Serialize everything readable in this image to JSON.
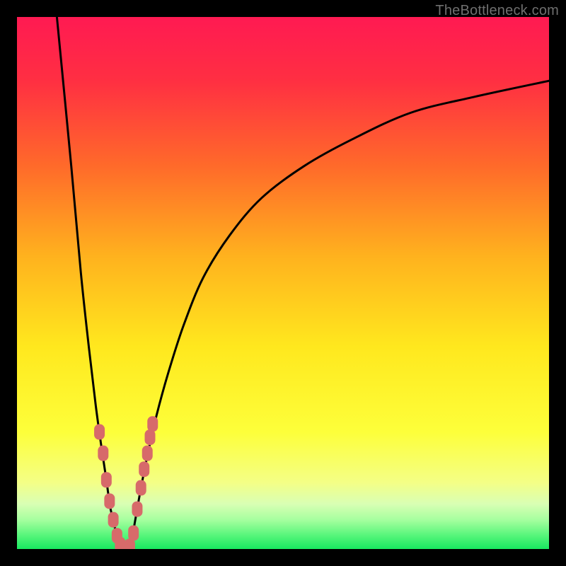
{
  "attribution": "TheBottleneck.com",
  "colors": {
    "frame": "#000000",
    "curve": "#000000",
    "marker": "#d76a6a",
    "gradient_stops": [
      {
        "offset": 0.0,
        "color": "#ff1a52"
      },
      {
        "offset": 0.12,
        "color": "#ff2f42"
      },
      {
        "offset": 0.28,
        "color": "#ff6a2a"
      },
      {
        "offset": 0.45,
        "color": "#ffb21e"
      },
      {
        "offset": 0.62,
        "color": "#ffe81e"
      },
      {
        "offset": 0.78,
        "color": "#fdff3a"
      },
      {
        "offset": 0.875,
        "color": "#f4ff86"
      },
      {
        "offset": 0.915,
        "color": "#d9ffb4"
      },
      {
        "offset": 0.945,
        "color": "#a6ff9f"
      },
      {
        "offset": 0.975,
        "color": "#55f57a"
      },
      {
        "offset": 1.0,
        "color": "#18e860"
      }
    ]
  },
  "chart_data": {
    "type": "line",
    "title": "",
    "xlabel": "",
    "ylabel": "",
    "xlim": [
      0,
      100
    ],
    "ylim": [
      0,
      100
    ],
    "series": [
      {
        "name": "left-branch",
        "x": [
          7.5,
          10.2,
          12.0,
          13.5,
          14.8,
          15.9,
          16.8,
          17.5,
          18.2,
          18.8,
          19.3
        ],
        "y": [
          100,
          72,
          52,
          38,
          27,
          19,
          13,
          8,
          5,
          2,
          0
        ]
      },
      {
        "name": "right-branch",
        "x": [
          21.3,
          21.8,
          22.5,
          23.4,
          24.6,
          26.2,
          28.4,
          31.3,
          35.0,
          40.0,
          46.0,
          54.0,
          63.0,
          74.0,
          86.0,
          100.0
        ],
        "y": [
          0,
          3,
          7,
          12,
          18,
          25,
          33,
          42,
          51,
          59,
          66,
          72,
          77,
          82,
          85,
          88
        ]
      }
    ],
    "markers": {
      "name": "data-points",
      "x": [
        15.5,
        16.2,
        16.8,
        17.4,
        18.1,
        18.8,
        19.4,
        20.2,
        21.2,
        21.9,
        22.6,
        23.3,
        23.9,
        24.5,
        25.0,
        25.5
      ],
      "y": [
        22.0,
        18.0,
        13.0,
        9.0,
        5.5,
        2.5,
        0.8,
        0.0,
        0.5,
        3.0,
        7.5,
        11.5,
        15.0,
        18.0,
        21.0,
        23.5
      ]
    },
    "floor": {
      "start_x": 19.3,
      "end_x": 21.3,
      "y": 0
    }
  }
}
